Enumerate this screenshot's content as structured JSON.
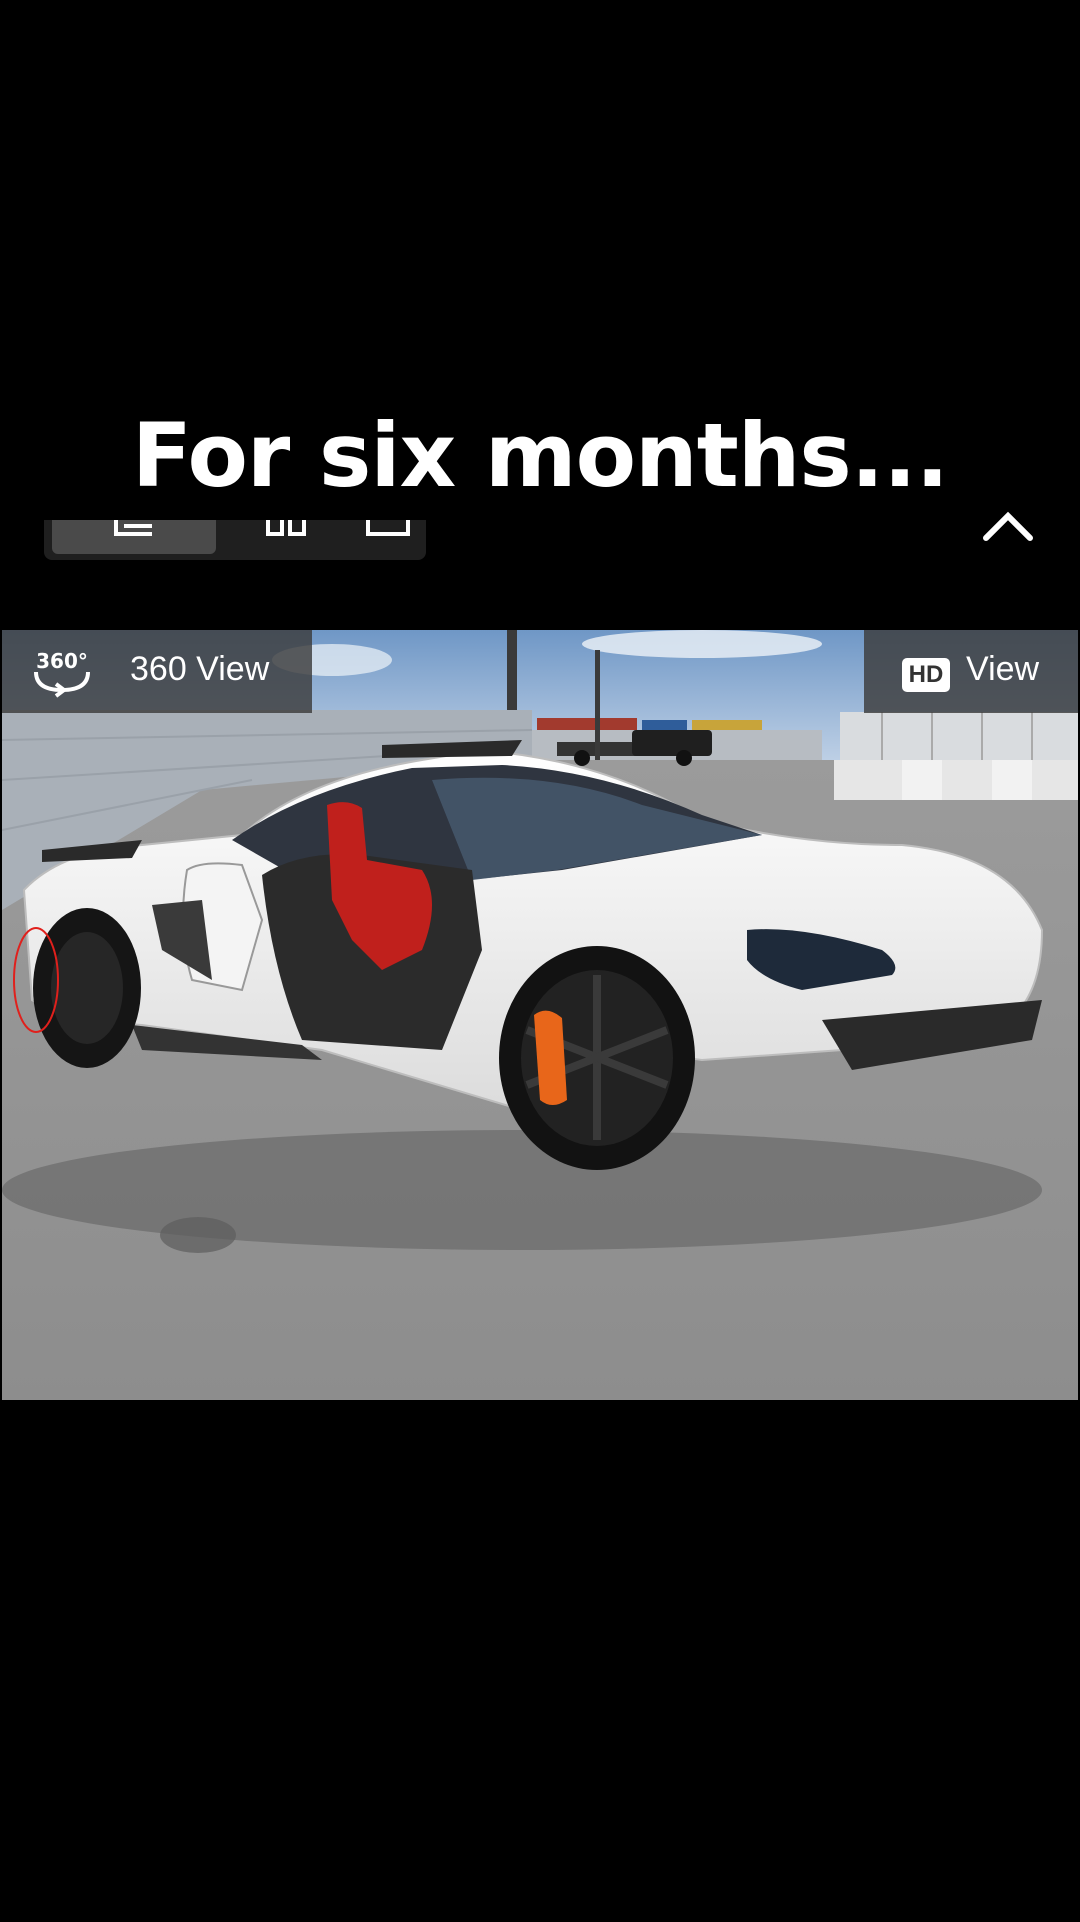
{
  "caption": "For six months...",
  "view_toggle": {
    "options": [
      {
        "icon": "list-view-icon",
        "selected": true
      },
      {
        "icon": "grid-view-icon",
        "selected": false
      },
      {
        "icon": "single-view-icon",
        "selected": false
      }
    ]
  },
  "collapse_icon": "chevron-up-icon",
  "photo": {
    "view_360": {
      "icon": "rotate-360-icon",
      "badge_text": "360°",
      "label": "360 View"
    },
    "hd_view": {
      "badge": "HD",
      "label": "View"
    }
  },
  "colors": {
    "background": "#000000",
    "car_body": "#f2f2f2",
    "seat": "#c0201c",
    "caliper": "#e8661a",
    "annotation_circle": "#e0201c"
  }
}
